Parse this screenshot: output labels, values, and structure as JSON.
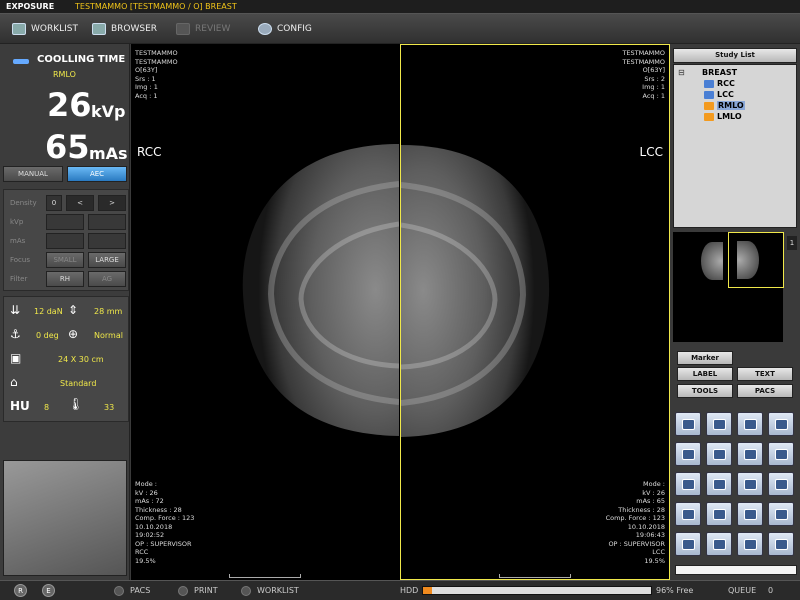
{
  "titlebar": {
    "app": "EXPOSURE",
    "patient": "TESTMAMMO [TESTMAMMO / O] BREAST"
  },
  "menu": [
    {
      "label": "WORKLIST",
      "icon": "worklist-icon"
    },
    {
      "label": "BROWSER",
      "icon": "browser-icon"
    },
    {
      "label": "REVIEW",
      "icon": "review-icon"
    },
    {
      "label": "CONFIG",
      "icon": "config-icon"
    }
  ],
  "exposure": {
    "cooling_label": "COOLLING TIME",
    "view": "RMLO",
    "kvp_value": "26",
    "kvp_unit": "kVp",
    "mas_value": "65",
    "mas_unit": "mAs",
    "manual_label": "MANUAL",
    "aec_label": "AEC",
    "density_label": "Density",
    "density_value": "0",
    "dec_label": "<",
    "inc_label": ">",
    "kvp_label": "kVp",
    "mas_label": "mAs",
    "focus_label": "Focus",
    "small_label": "SMALL",
    "large_label": "LARGE",
    "filter_label": "Filter",
    "rh_label": "RH",
    "ag_label": "AG"
  },
  "params": {
    "force": "12 daN",
    "thickness": "28 mm",
    "angle": "0 deg",
    "zoom": "Normal",
    "cassette": "24 X 30 cm",
    "mode": "Standard",
    "hu_label": "HU",
    "hu_value": "8",
    "temp": "33"
  },
  "left_view": {
    "label": "RCC",
    "header": "TESTMAMMO\nTESTMAMMO\nO[63Y]\nSrs : 1\nImg : 1\nAcq : 1",
    "footer": "Mode :\nkV : 26\nmAs : 72\nThickness : 28\nComp. Force : 123\n10.10.2018\n19:02:52\nOP : SUPERVISOR\nRCC\n19.5%"
  },
  "right_view": {
    "label": "LCC",
    "header": "TESTMAMMO\nTESTMAMMO\nO[63Y]\nSrs : 2\nImg : 1\nAcq : 1",
    "footer": "Mode :\nkV : 26\nmAs : 65\nThickness : 28\nComp. Force : 123\n10.10.2018\n19:06:43\nOP : SUPERVISOR\nLCC\n19.5%"
  },
  "study_list": {
    "title": "Study List",
    "root": "BREAST",
    "items": [
      {
        "label": "RCC",
        "tag_color": "#4a7fd4",
        "tag": "Y"
      },
      {
        "label": "LCC",
        "tag_color": "#4a7fd4",
        "tag": "Y"
      },
      {
        "label": "RMLO",
        "tag_color": "#f39a1e",
        "tag": "R"
      },
      {
        "label": "LMLO",
        "tag_color": "#f39a1e",
        "tag": "R"
      }
    ]
  },
  "thumb_count": "1",
  "right_buttons": {
    "marker": "Marker",
    "label": "LABEL",
    "text": "TEXT",
    "tools": "TOOLS",
    "pacs": "PACS"
  },
  "tools": [
    "layout-4-icon",
    "layout-2-icon",
    "layout-hanging-icon",
    "rotate-icon",
    "magnifier-icon",
    "zoom-icon",
    "pan-icon",
    "refresh-icon",
    "measure-icon",
    "image-icon",
    "print-icon",
    "flip-icon",
    "copy-icon",
    "paste-icon",
    "delete-icon",
    "edit-icon",
    "move-left-icon",
    "move-right-icon",
    "export-icon",
    "import-icon"
  ],
  "status": {
    "r_label": "R",
    "e_label": "E",
    "pacs": "PACS",
    "print": "PRINT",
    "worklist": "WORKLIST",
    "hdd_label": "HDD",
    "hdd_free": "96% Free",
    "hdd_used_fraction": 0.04,
    "queue_label": "QUEUE",
    "queue_value": "0"
  }
}
